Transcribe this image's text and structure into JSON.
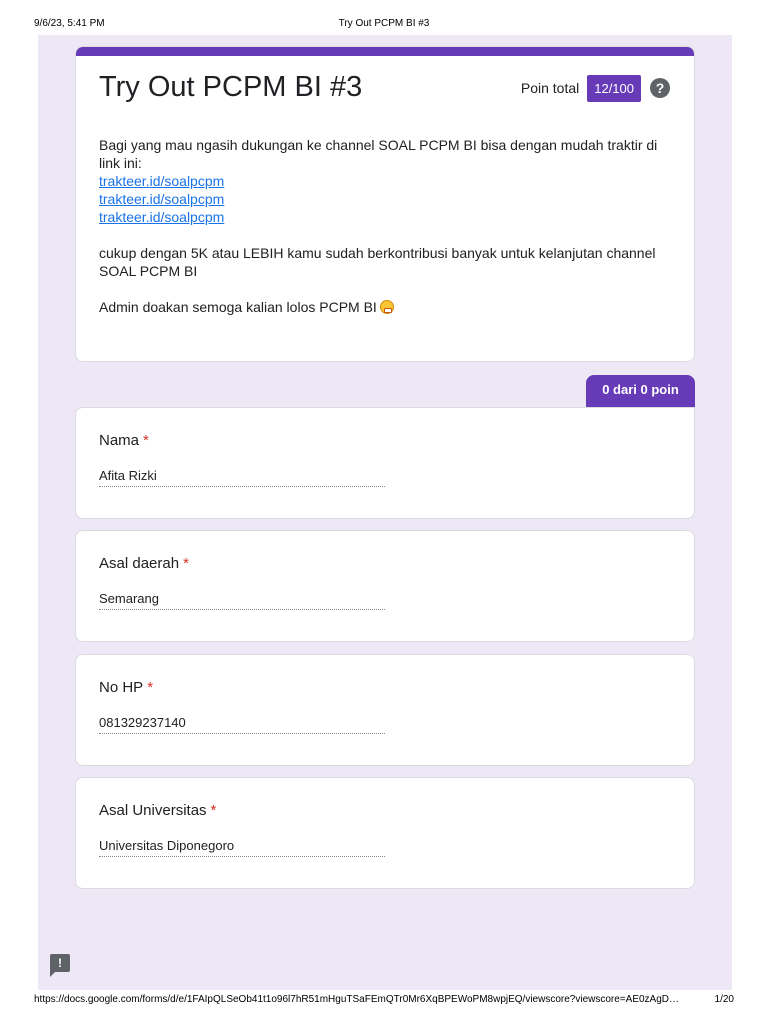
{
  "print": {
    "datetime": "9/6/23, 5:41 PM",
    "title": "Try Out PCPM BI #3",
    "url": "https://docs.google.com/forms/d/e/1FAIpQLSeOb41t1o96l7hR51mHguTSaFEmQTr0Mr6XqBPEWoPM8wpjEQ/viewscore?viewscore=AE0zAgD…",
    "page": "1/20"
  },
  "form": {
    "title": "Try Out PCPM BI #3",
    "score_label": "Poin total",
    "score_value": "12/100",
    "help_icon": "?",
    "description": {
      "intro": "Bagi yang mau ngasih dukungan ke channel SOAL PCPM BI bisa dengan mudah traktir di link ini:",
      "links": [
        "trakteer.id/soalpcpm",
        "trakteer.id/soalpcpm",
        "trakteer.id/soalpcpm"
      ],
      "contribution": "cukup dengan 5K atau LEBIH kamu sudah berkontribusi banyak untuk kelanjutan channel SOAL PCPM BI",
      "closing": "Admin doakan semoga kalian lolos PCPM BI"
    },
    "section_points": "0 dari 0 poin",
    "required_mark": "*",
    "questions": [
      {
        "label": "Nama",
        "answer": "Afita Rizki"
      },
      {
        "label": "Asal daerah",
        "answer": "Semarang"
      },
      {
        "label": "No HP",
        "answer": "081329237140"
      },
      {
        "label": "Asal Universitas",
        "answer": "Universitas Diponegoro"
      }
    ]
  },
  "icons": {
    "help": "help-icon",
    "feedback": "feedback-icon",
    "emoji": "grimacing-face-emoji",
    "feedback_glyph": "!"
  },
  "colors": {
    "accent": "#673ab7",
    "background": "#ede7f6",
    "link": "#1a73e8",
    "required": "#d93025"
  }
}
